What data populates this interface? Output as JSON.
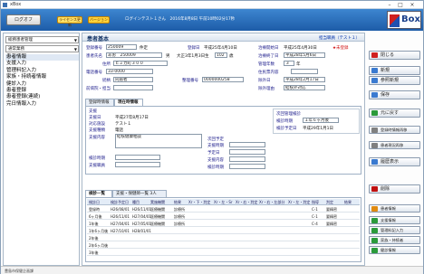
{
  "titlebar": {
    "title": "xBox"
  },
  "toolbar": {
    "logout_label": "ログオフ",
    "chip1": "ライセンス更新",
    "chip2": "バージョン",
    "info": "ログインテスト１さん　2016年8月8日 午前10時02分17秒",
    "logo_text": "Box"
  },
  "sidebar": {
    "select1": "総務患者管理",
    "select2": "通常業務",
    "items": [
      {
        "label": "患者情報"
      },
      {
        "label": "支援入力"
      },
      {
        "label": "管理料記入力"
      },
      {
        "label": "家族・持続者情報"
      },
      {
        "label": "健診入力"
      },
      {
        "label": "患者登録"
      },
      {
        "label": "患者登録(連続)"
      },
      {
        "label": "完日情報入力"
      }
    ]
  },
  "main": {
    "title": "患者基本",
    "staff": "担当職員（テスト１）",
    "fields": {
      "patient_no_label": "登録番号",
      "patient_no": "250009",
      "patient_kind": "件定",
      "reg_date_label": "登録日",
      "reg_date": "平成25年4月10日",
      "start_date_label": "治療開始日",
      "start_date": "平成25年4月30日",
      "unreg": "★未登録",
      "kana_label": "患者氏名",
      "kana": "あお　250009",
      "sex": "男",
      "birth": "大正3年1月3日生",
      "age": "102",
      "age_unit": "歳",
      "end_date_label": "治療終了日",
      "end_date": "平成28年5月6日",
      "addr_label": "住所",
      "addr": "ヒミカ町３００",
      "period_label": "管理年数",
      "period": "３",
      "period_unit": "年",
      "tel_label": "電話番号",
      "tel": "33-0000",
      "residence_label": "住民票内容",
      "contact_label": "続柄",
      "contact": "同居者",
      "reg2_label": "整理番号",
      "reg2": "0000000258",
      "exit_date_label": "除外日",
      "exit_date": "平成28年2月17日",
      "prev_label": "前病院・担当",
      "exit_reason_label": "除外理由",
      "exit_reason": "結核外対応"
    },
    "tabs": [
      "登録時情報",
      "現在時情報"
    ],
    "support": {
      "title": "支援",
      "date_label": "支援日",
      "date": "平成27年8月17日",
      "method_label": "対応施設",
      "method": "テスト１",
      "kind_label": "支援種類",
      "kind": "電話",
      "content_label": "支援内容",
      "content": "結核健康相談",
      "next_label": "次回予定",
      "plan_label": "支援時期",
      "place_label": "予定日",
      "purpose_label": "支援内容",
      "ready_label": "検診時期",
      "staff_label": "支援職員",
      "next_staff_label": "検診時期"
    },
    "next": {
      "title": "次回管理検診",
      "timing_label": "検診時期",
      "timing": "１年６ヶ月後",
      "plan_label": "検診予定日",
      "plan": "平成29年1月1日"
    },
    "grid_tabs": [
      "検診一覧",
      "支援・保健師一覧 3人"
    ],
    "grid_headers": [
      "検診日",
      "検診予定日",
      "種目",
      "実施機関",
      "結果",
      "Xr・下・判定",
      "Xr・左・Sr",
      "Xr・右・判定",
      "Xr・右・左部分",
      "Xr・左・判定",
      "指導",
      "判定",
      "結果"
    ],
    "grid_rows": [
      [
        "登録時",
        "H26/08/01",
        "H26/11/01",
        "医療機関",
        "診療所",
        "",
        "",
        "",
        "",
        "",
        "C-1",
        "要精密"
      ],
      [
        "6ヶ月後",
        "H26/11/01",
        "H27/04/01",
        "医療機関",
        "診療所",
        "",
        "",
        "",
        "",
        "",
        "C-1",
        "要精密"
      ],
      [
        "1年後",
        "H27/04/01",
        "H27/05/01",
        "医療機関",
        "診療所",
        "",
        "",
        "",
        "",
        "",
        "C-4",
        "要精密"
      ],
      [
        "1年6ヶ月後",
        "H27/10/01",
        "H28/01/01",
        "",
        "",
        "",
        "",
        "",
        "",
        "",
        "",
        ""
      ],
      [
        "2年後",
        "",
        "",
        "",
        "",
        "",
        "",
        "",
        "",
        "",
        "",
        ""
      ],
      [
        "2年6ヶ月後",
        "",
        "",
        "",
        "",
        "",
        "",
        "",
        "",
        "",
        "",
        ""
      ],
      [
        "3年後",
        "",
        "",
        "",
        "",
        "",
        "",
        "",
        "",
        "",
        "",
        ""
      ]
    ]
  },
  "right_buttons": [
    {
      "label": "閉じる",
      "color": "#d02020"
    },
    {
      "label": "新規",
      "color": "#3a7ad0"
    },
    {
      "label": "参照新規",
      "color": "#3a7ad0"
    },
    {
      "label": "保存",
      "color": "#3a7ad0"
    },
    {
      "label": "元に戻す",
      "color": "#2a9a3a"
    },
    {
      "label": "登録時情報再移",
      "color": "#808080"
    },
    {
      "label": "患者現況再移",
      "color": "#808080"
    },
    {
      "label": "履歴表示",
      "color": "#3a7ad0"
    },
    {
      "label": "削除",
      "color": "#c01010"
    },
    {
      "label": "患者情報",
      "color": "#e08a10"
    },
    {
      "label": "支援情報",
      "color": "#2a9a3a"
    },
    {
      "label": "管理料記入力",
      "color": "#2a9a3a"
    },
    {
      "label": "家族・持続者",
      "color": "#2a9a3a"
    },
    {
      "label": "健診情報",
      "color": "#2a9a3a"
    }
  ],
  "statusbar": {
    "text": "豊島市保健企画課"
  }
}
